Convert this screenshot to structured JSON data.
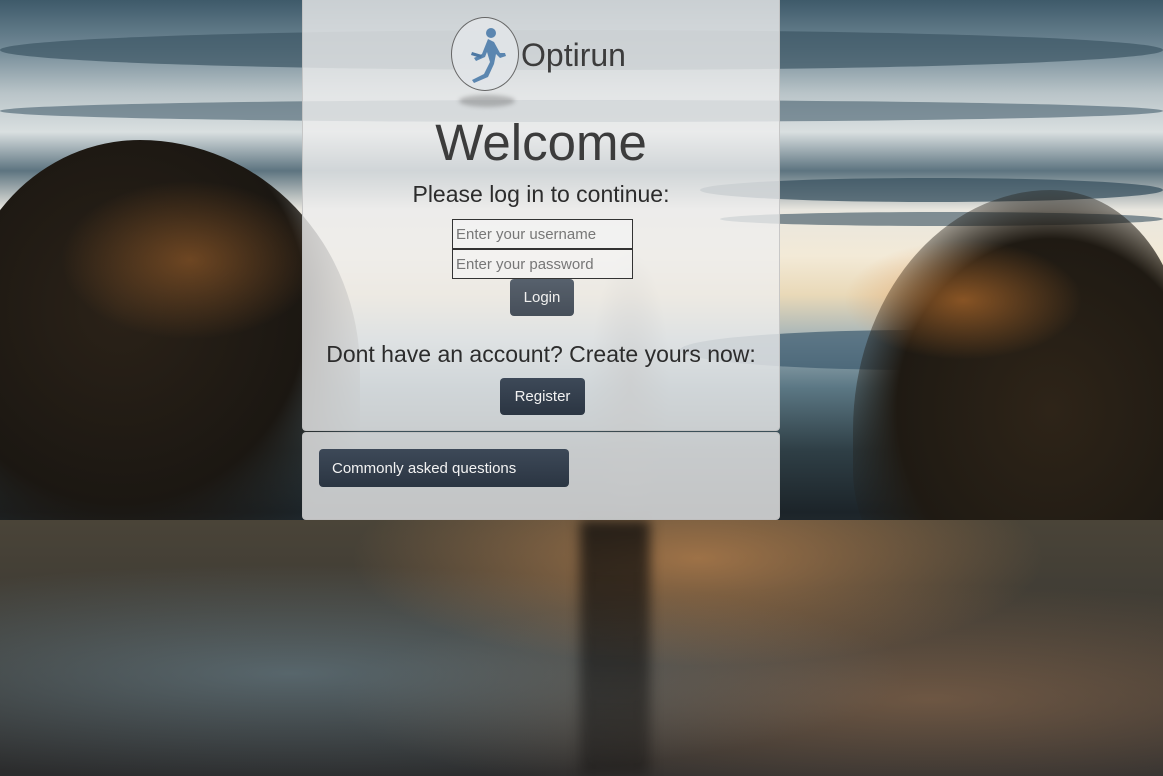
{
  "brand": {
    "name": "Optirun",
    "logo_icon": "runner-icon"
  },
  "login": {
    "heading": "Welcome",
    "subtitle": "Please log in to continue:",
    "username_placeholder": "Enter your username",
    "password_placeholder": "Enter your password",
    "username_value": "",
    "password_value": "",
    "login_label": "Login"
  },
  "register": {
    "prompt": "Dont have an account? Create yours now:",
    "register_label": "Register"
  },
  "faq": {
    "button_label": "Commonly asked questions"
  },
  "colors": {
    "button": "#333e4c",
    "panel": "#eeeeee",
    "logo_runner": "#5b86b0"
  }
}
